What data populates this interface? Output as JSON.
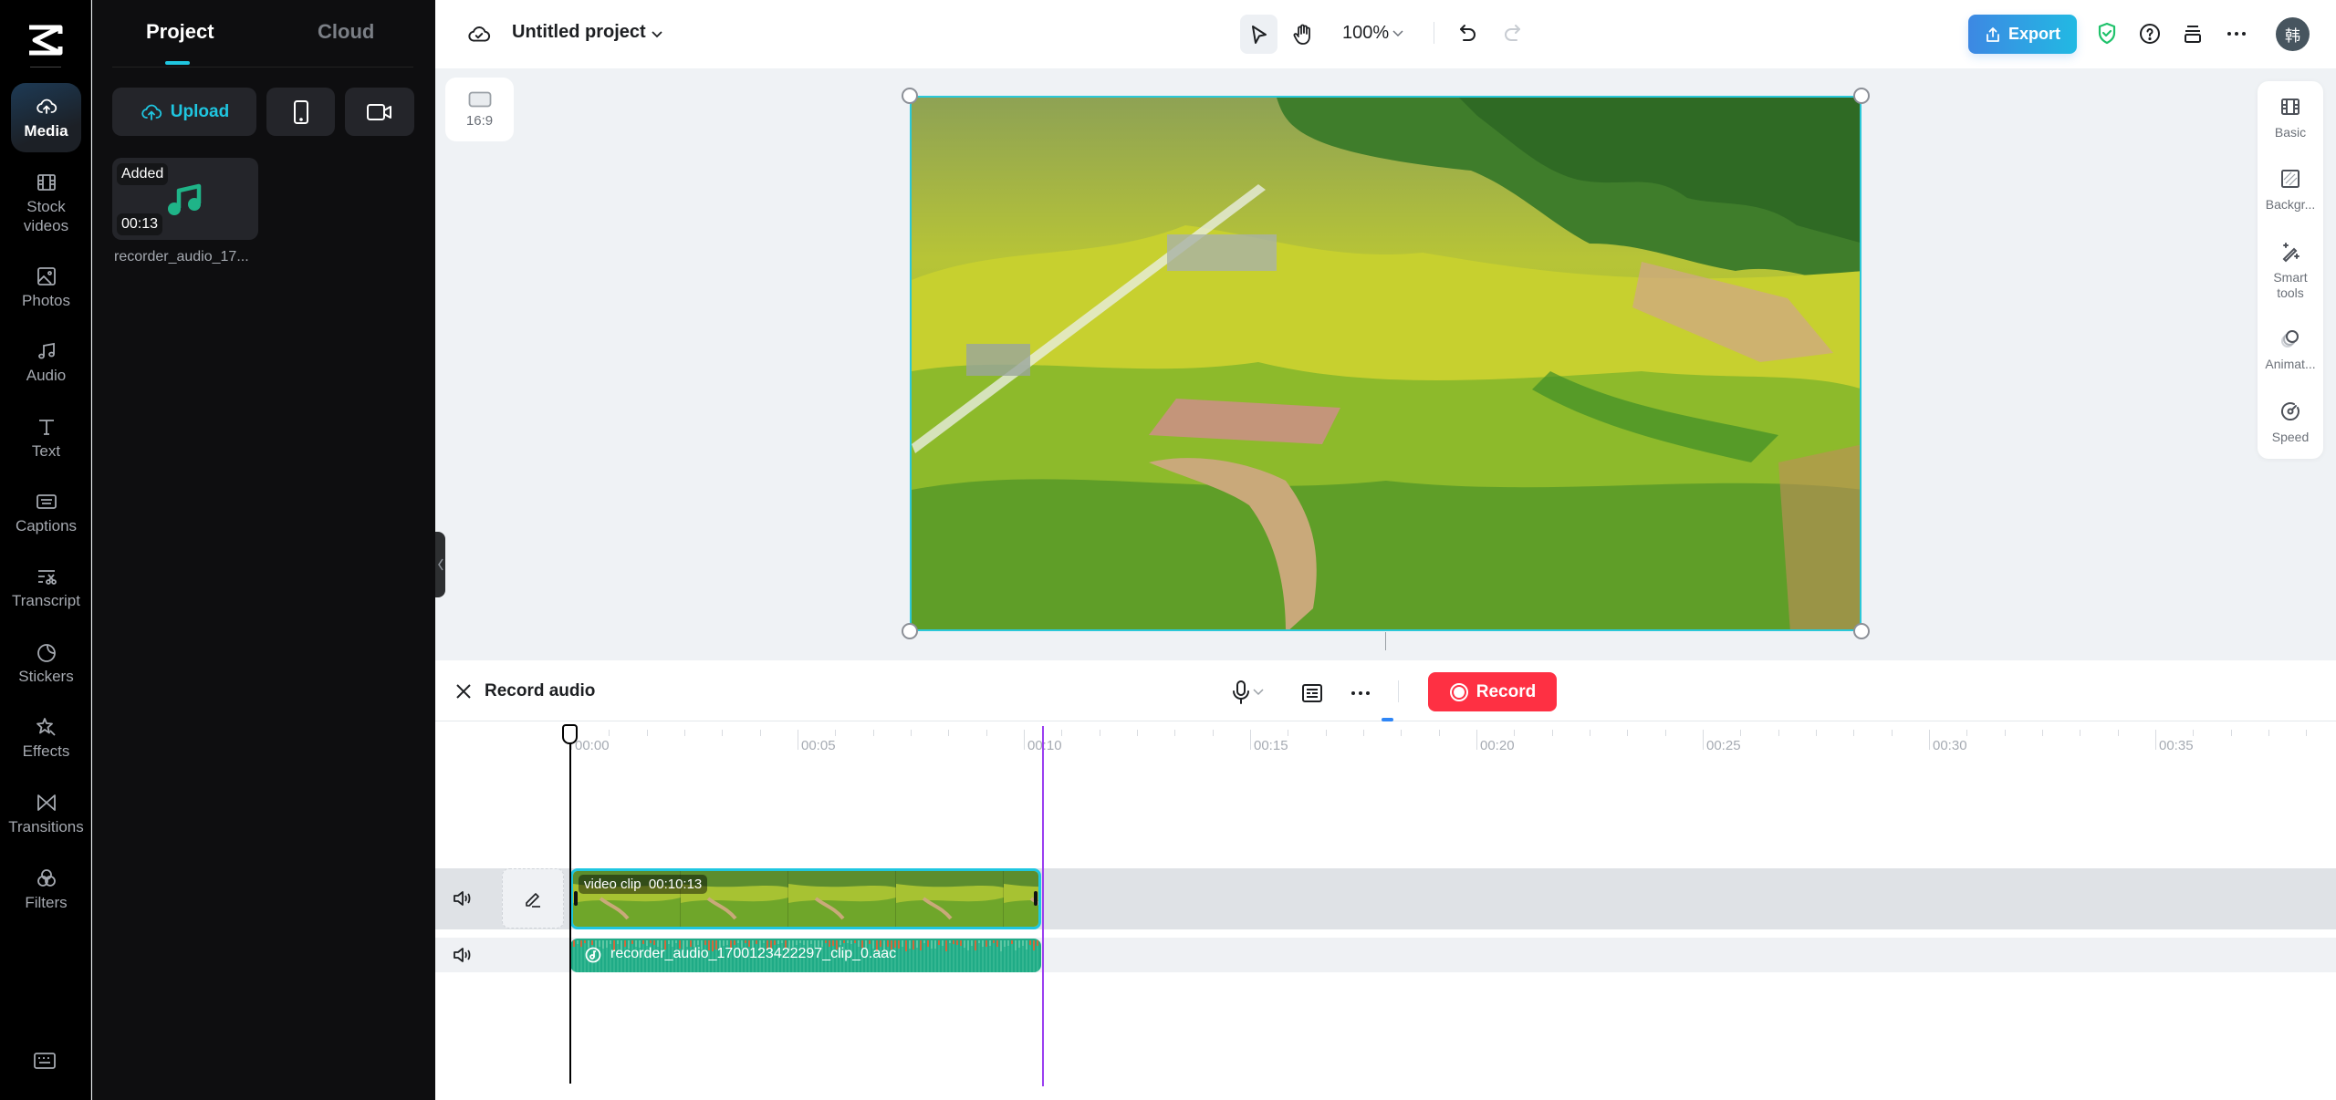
{
  "sidebar": {
    "items": [
      {
        "label": "Media",
        "icon": "cloud-upload-icon",
        "active": true
      },
      {
        "label": "Stock videos",
        "icon": "film-icon",
        "active": false
      },
      {
        "label": "Photos",
        "icon": "image-icon",
        "active": false
      },
      {
        "label": "Audio",
        "icon": "music-note-icon",
        "active": false
      },
      {
        "label": "Text",
        "icon": "text-t-icon",
        "active": false
      },
      {
        "label": "Captions",
        "icon": "captions-icon",
        "active": false
      },
      {
        "label": "Transcript",
        "icon": "transcript-scissors-icon",
        "active": false
      },
      {
        "label": "Stickers",
        "icon": "sticker-icon",
        "active": false
      },
      {
        "label": "Effects",
        "icon": "sparkle-star-icon",
        "active": false
      },
      {
        "label": "Transitions",
        "icon": "bowtie-transition-icon",
        "active": false
      },
      {
        "label": "Filters",
        "icon": "filters-circles-icon",
        "active": false
      }
    ]
  },
  "panel": {
    "tabs": [
      {
        "label": "Project",
        "active": true
      },
      {
        "label": "Cloud",
        "active": false
      }
    ],
    "upload_label": "Upload",
    "media_item": {
      "badge": "Added",
      "duration": "00:13",
      "name": "recorder_audio_17..."
    }
  },
  "header": {
    "project_title": "Untitled project",
    "zoom": "100%",
    "export_label": "Export",
    "avatar_initial": "韩"
  },
  "canvas": {
    "aspect_ratio": "16:9"
  },
  "right_panel": {
    "items": [
      {
        "label": "Basic",
        "icon": "film-icon"
      },
      {
        "label": "Backgr...",
        "icon": "background-hatch-icon"
      },
      {
        "label": "Smart tools",
        "icon": "magic-wand-icon"
      },
      {
        "label": "Animat...",
        "icon": "animation-circles-icon"
      },
      {
        "label": "Speed",
        "icon": "speedometer-icon"
      }
    ]
  },
  "record_audio": {
    "title": "Record audio",
    "record_label": "Record"
  },
  "timeline": {
    "ruler_labels": [
      "00:00",
      "00:05",
      "00:10",
      "00:15",
      "00:20",
      "00:25",
      "00:30",
      "00:35"
    ],
    "video_clip": {
      "label": "video clip",
      "duration": "00:10:13"
    },
    "audio_clip": {
      "name": "recorder_audio_1700123422297_clip_0.aac"
    }
  },
  "colors": {
    "accent": "#1fc6e0",
    "record": "#fe3043",
    "audio_clip": "#1fab86",
    "export_start": "#3d88e3",
    "export_end": "#22b9e3",
    "end_marker": "#9b3ff0"
  }
}
